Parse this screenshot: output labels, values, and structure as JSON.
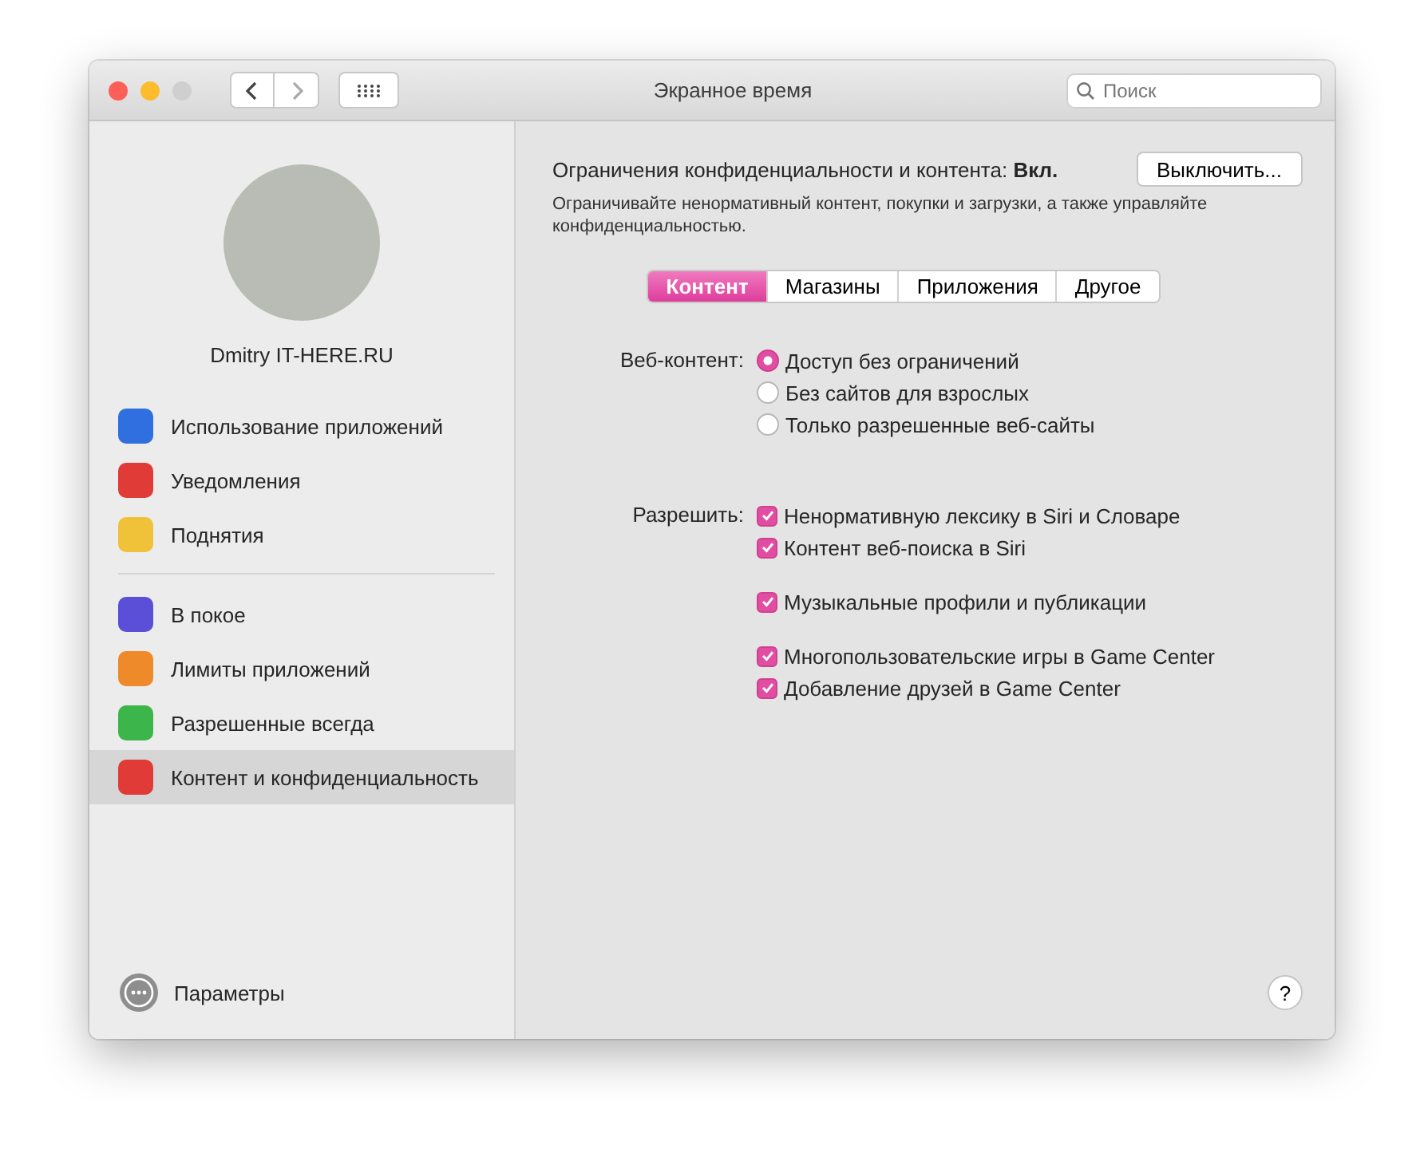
{
  "window": {
    "title": "Экранное время",
    "search": {
      "placeholder": "Поиск"
    }
  },
  "sidebar": {
    "user": {
      "name": "Dmitry IT-HERE.RU"
    },
    "sections": [
      [
        {
          "label": "Использование приложений",
          "selected": false
        },
        {
          "label": "Уведомления",
          "selected": false
        },
        {
          "label": "Поднятия",
          "selected": false
        }
      ],
      [
        {
          "label": "В покое",
          "selected": false
        },
        {
          "label": "Лимиты приложений",
          "selected": false
        },
        {
          "label": "Разрешенные всегда",
          "selected": false
        },
        {
          "label": "Контент и конфиденциальность",
          "selected": true
        }
      ]
    ],
    "footer": {
      "label": "Параметры"
    }
  },
  "main": {
    "status": "Ограничения конфиденциальности и контента: **Вкл.**",
    "turn_off_button": "Выключить...",
    "description": "Ограничивайте ненормативный контент, покупки и загрузки, а также управляйте конфиденциальностью.",
    "tabs": [
      {
        "label": "Контент",
        "selected": true
      },
      {
        "label": "Магазины",
        "selected": false
      },
      {
        "label": "Приложения",
        "selected": false
      },
      {
        "label": "Другое",
        "selected": false
      }
    ],
    "web_content": {
      "label": "Веб-контент:",
      "options": [
        {
          "label": "Доступ без ограничений",
          "selected": true
        },
        {
          "label": "Без сайтов для взрослых",
          "selected": false
        },
        {
          "label": "Только разрешенные веб-сайты",
          "selected": false
        }
      ]
    },
    "allow": {
      "label": "Разрешить:",
      "groups": [
        [
          {
            "label": "Ненормативную лексику в Siri и Словаре",
            "checked": true
          },
          {
            "label": "Контент веб-поиска в Siri",
            "checked": true
          }
        ],
        [
          {
            "label": "Музыкальные профили и публикации",
            "checked": true
          }
        ],
        [
          {
            "label": "Многопользовательские игры в Game Center",
            "checked": true
          },
          {
            "label": "Добавление друзей в Game Center",
            "checked": true
          }
        ]
      ]
    },
    "help_button": "?"
  }
}
